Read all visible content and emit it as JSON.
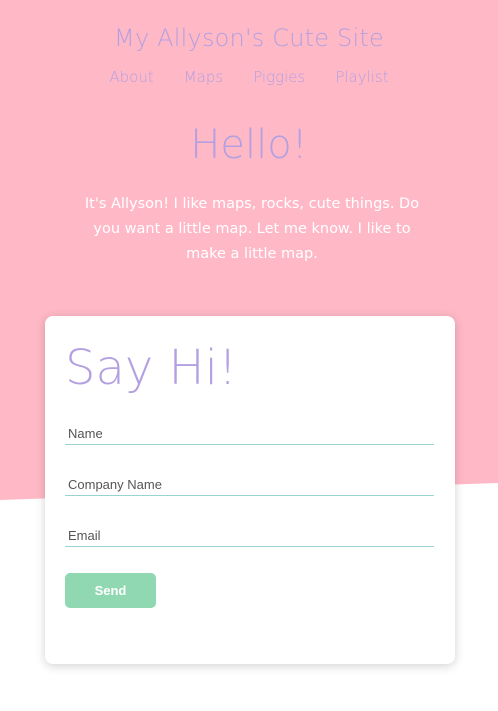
{
  "site": {
    "title": "My Allyson's Cute Site"
  },
  "nav": {
    "items": [
      {
        "label": "About"
      },
      {
        "label": "Maps"
      },
      {
        "label": "Piggies"
      },
      {
        "label": "Playlist"
      }
    ]
  },
  "hero": {
    "heading": "Hello!",
    "text": "It's Allyson! I like maps, rocks, cute things. Do you want a little map. Let me know. I like to make a little map."
  },
  "contact_form": {
    "title": "Say Hi!",
    "fields": [
      {
        "placeholder": "Name",
        "value": ""
      },
      {
        "placeholder": "Company Name",
        "value": ""
      },
      {
        "placeholder": "Email",
        "value": ""
      }
    ],
    "submit_label": "Send"
  },
  "colors": {
    "pink_background": "#ffb8c6",
    "lavender_text": "#b3a0e0",
    "send_button": "#90d8b2",
    "field_underline": "#9ad3d0"
  }
}
